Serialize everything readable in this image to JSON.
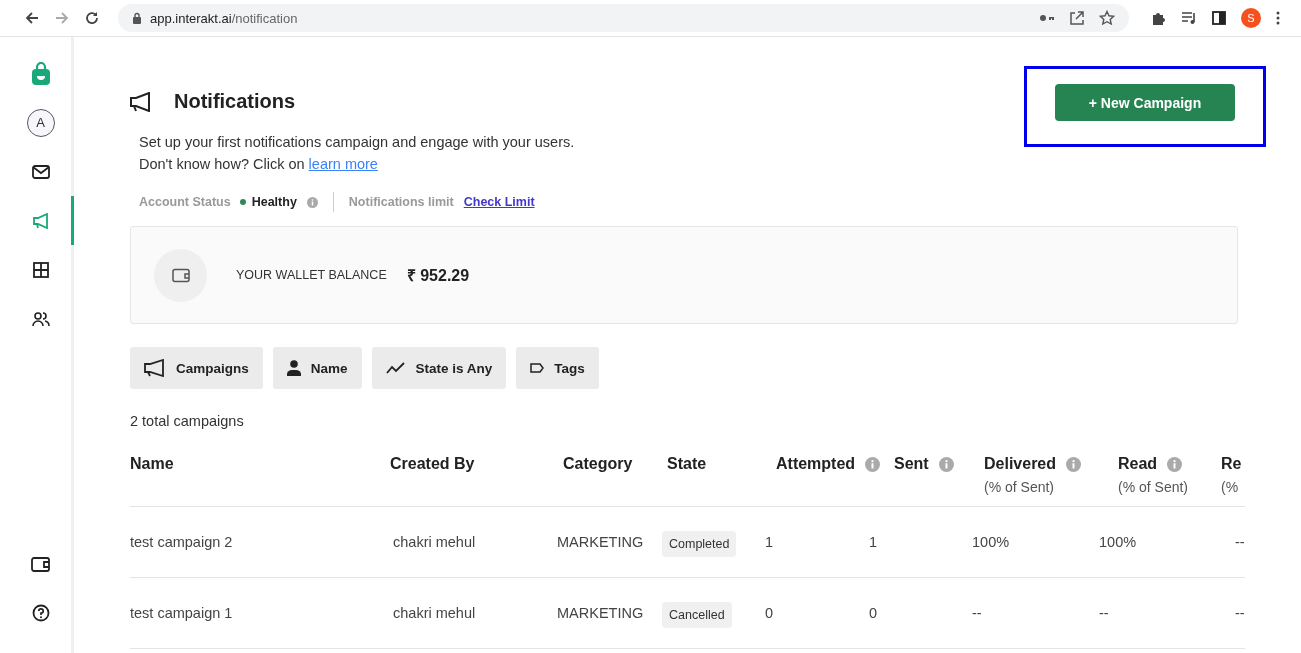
{
  "browser": {
    "url_host": "app.interakt.ai",
    "url_path": "/notification",
    "profile_initial": "S"
  },
  "sidebar": {
    "items": [
      {
        "kind": "logo",
        "selected": false
      },
      {
        "kind": "avatar",
        "label": "A",
        "selected": false
      },
      {
        "kind": "mail",
        "selected": false
      },
      {
        "kind": "megaphone",
        "selected": true
      },
      {
        "kind": "grid",
        "selected": false
      },
      {
        "kind": "users",
        "selected": false
      }
    ],
    "bottom_items": [
      {
        "kind": "wallet"
      },
      {
        "kind": "help"
      }
    ]
  },
  "header": {
    "title": "Notifications",
    "new_campaign_button": "+ New Campaign",
    "button_highlighted": true
  },
  "intro": {
    "line_1": "Set up your first notifications campaign and engage with your users.",
    "line_2": "Don't know how? Click on",
    "link": "learn more"
  },
  "status": {
    "account_status_label": "Account Status",
    "account_status": "Healthy",
    "limit_label": "Notifications limit",
    "limit_link": "Check Limit"
  },
  "wallet": {
    "label": "YOUR WALLET BALANCE",
    "balance": "₹ 952.29"
  },
  "filters": [
    {
      "kind": "megaphone",
      "label": "Campaigns"
    },
    {
      "kind": "person",
      "label": "Name"
    },
    {
      "kind": "trend",
      "label": "State is Any"
    },
    {
      "kind": "tag",
      "label": "Tags"
    }
  ],
  "total": "2 total campaigns",
  "table": {
    "columns": [
      {
        "label": "Name",
        "info": false
      },
      {
        "label": "Created By",
        "info": false
      },
      {
        "label": "Category",
        "info": false
      },
      {
        "label": "State",
        "info": false
      },
      {
        "label": "Attempted",
        "info": true
      },
      {
        "label": "Sent",
        "info": true
      },
      {
        "label": "Delivered",
        "sub": "(% of Sent)",
        "info": true
      },
      {
        "label": "Read",
        "sub": "(% of Sent)",
        "info": true
      },
      {
        "label": "Re",
        "sub": "(%",
        "info": false
      }
    ],
    "rows": [
      {
        "cells": [
          "test campaign 2",
          "chakri mehul",
          "MARKETING",
          "Completed",
          "1",
          "1",
          "100%",
          "100%",
          "--"
        ]
      },
      {
        "cells": [
          "test campaign 1",
          "chakri mehul",
          "MARKETING",
          "Cancelled",
          "0",
          "0",
          "--",
          "--",
          "--"
        ]
      }
    ]
  }
}
